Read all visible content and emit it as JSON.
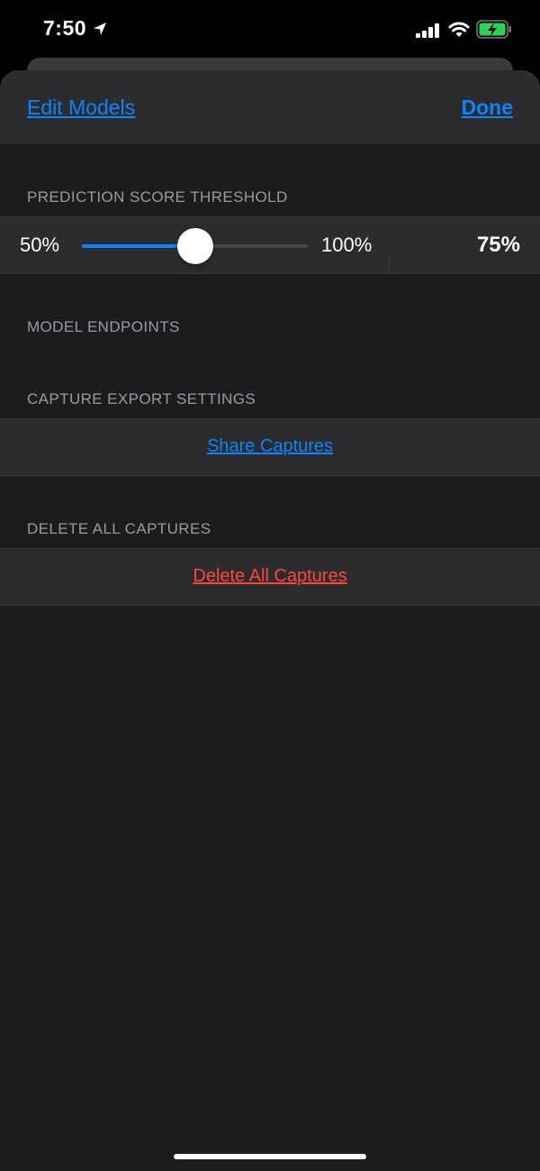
{
  "status_bar": {
    "time": "7:50",
    "icons": [
      "location-arrow-icon",
      "cellular-signal-icon",
      "wifi-icon",
      "battery-charging-icon"
    ]
  },
  "nav": {
    "left_label": "Edit Models",
    "right_label": "Done"
  },
  "sections": {
    "threshold_header": "PREDICTION SCORE THRESHOLD",
    "endpoints_header": "MODEL ENDPOINTS",
    "export_header": "CAPTURE EXPORT SETTINGS",
    "delete_header": "DELETE ALL CAPTURES"
  },
  "slider": {
    "min_label": "50%",
    "max_label": "100%",
    "value_label": "75%",
    "value_fraction": 0.5
  },
  "actions": {
    "share_label": "Share Captures",
    "delete_label": "Delete All Captures"
  },
  "colors": {
    "accent": "#0a84ff",
    "destructive": "#ff453a",
    "background": "#1c1c1e",
    "row_background": "#2c2c2e",
    "header_text": "#9a9aa0"
  }
}
